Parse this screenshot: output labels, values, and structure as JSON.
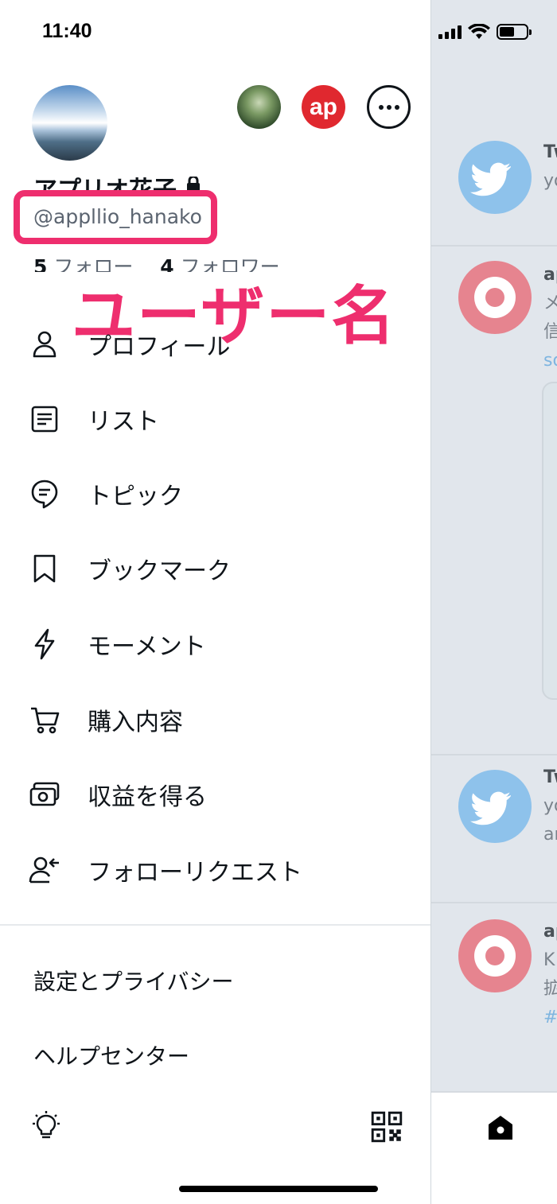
{
  "status_bar": {
    "time": "11:40"
  },
  "profile": {
    "display_name": "アプリオ花子",
    "handle": "@appllio_hanako",
    "following_count": "5",
    "following_label": "フォロー",
    "followers_count": "4",
    "followers_label": "フォロワー"
  },
  "other_accounts": [
    {
      "icon": "forest-avatar"
    },
    {
      "icon": "ap-logo-avatar",
      "text": "ap"
    }
  ],
  "annotation": {
    "text": "ユーザー名",
    "color": "#ee2e6e"
  },
  "menu": {
    "items": [
      {
        "icon": "person-icon",
        "label": "プロフィール"
      },
      {
        "icon": "list-icon",
        "label": "リスト"
      },
      {
        "icon": "topic-icon",
        "label": "トピック"
      },
      {
        "icon": "bookmark-icon",
        "label": "ブックマーク"
      },
      {
        "icon": "lightning-icon",
        "label": "モーメント"
      },
      {
        "icon": "cart-icon",
        "label": "購入内容"
      },
      {
        "icon": "money-icon",
        "label": "収益を得る"
      },
      {
        "icon": "follow-request-icon",
        "label": "フォローリクエスト"
      }
    ]
  },
  "settings": {
    "privacy_label": "設定とプライバシー",
    "help_label": "ヘルプセンター"
  },
  "bottom_bar": {
    "left_icon": "lightbulb-icon",
    "right_icon": "qr-code-icon"
  },
  "timeline_peek": {
    "items": [
      {
        "avatar": "twitter-avatar",
        "lines": [
          "Tw",
          "yo"
        ]
      },
      {
        "avatar": "ap-avatar",
        "lines": [
          "ap",
          "メ",
          "信",
          "so"
        ]
      },
      {
        "avatar": "twitter-avatar",
        "lines": [
          "Tw",
          "yo",
          "ar"
        ]
      },
      {
        "avatar": "ap-avatar",
        "lines": [
          "ap",
          "K",
          "拡",
          "#"
        ]
      }
    ],
    "bottom_icon": "home-icon"
  },
  "colors": {
    "accent": "#ee2e6e",
    "twitter_blue": "#8ec2eb",
    "ap_red": "#e0282f"
  }
}
